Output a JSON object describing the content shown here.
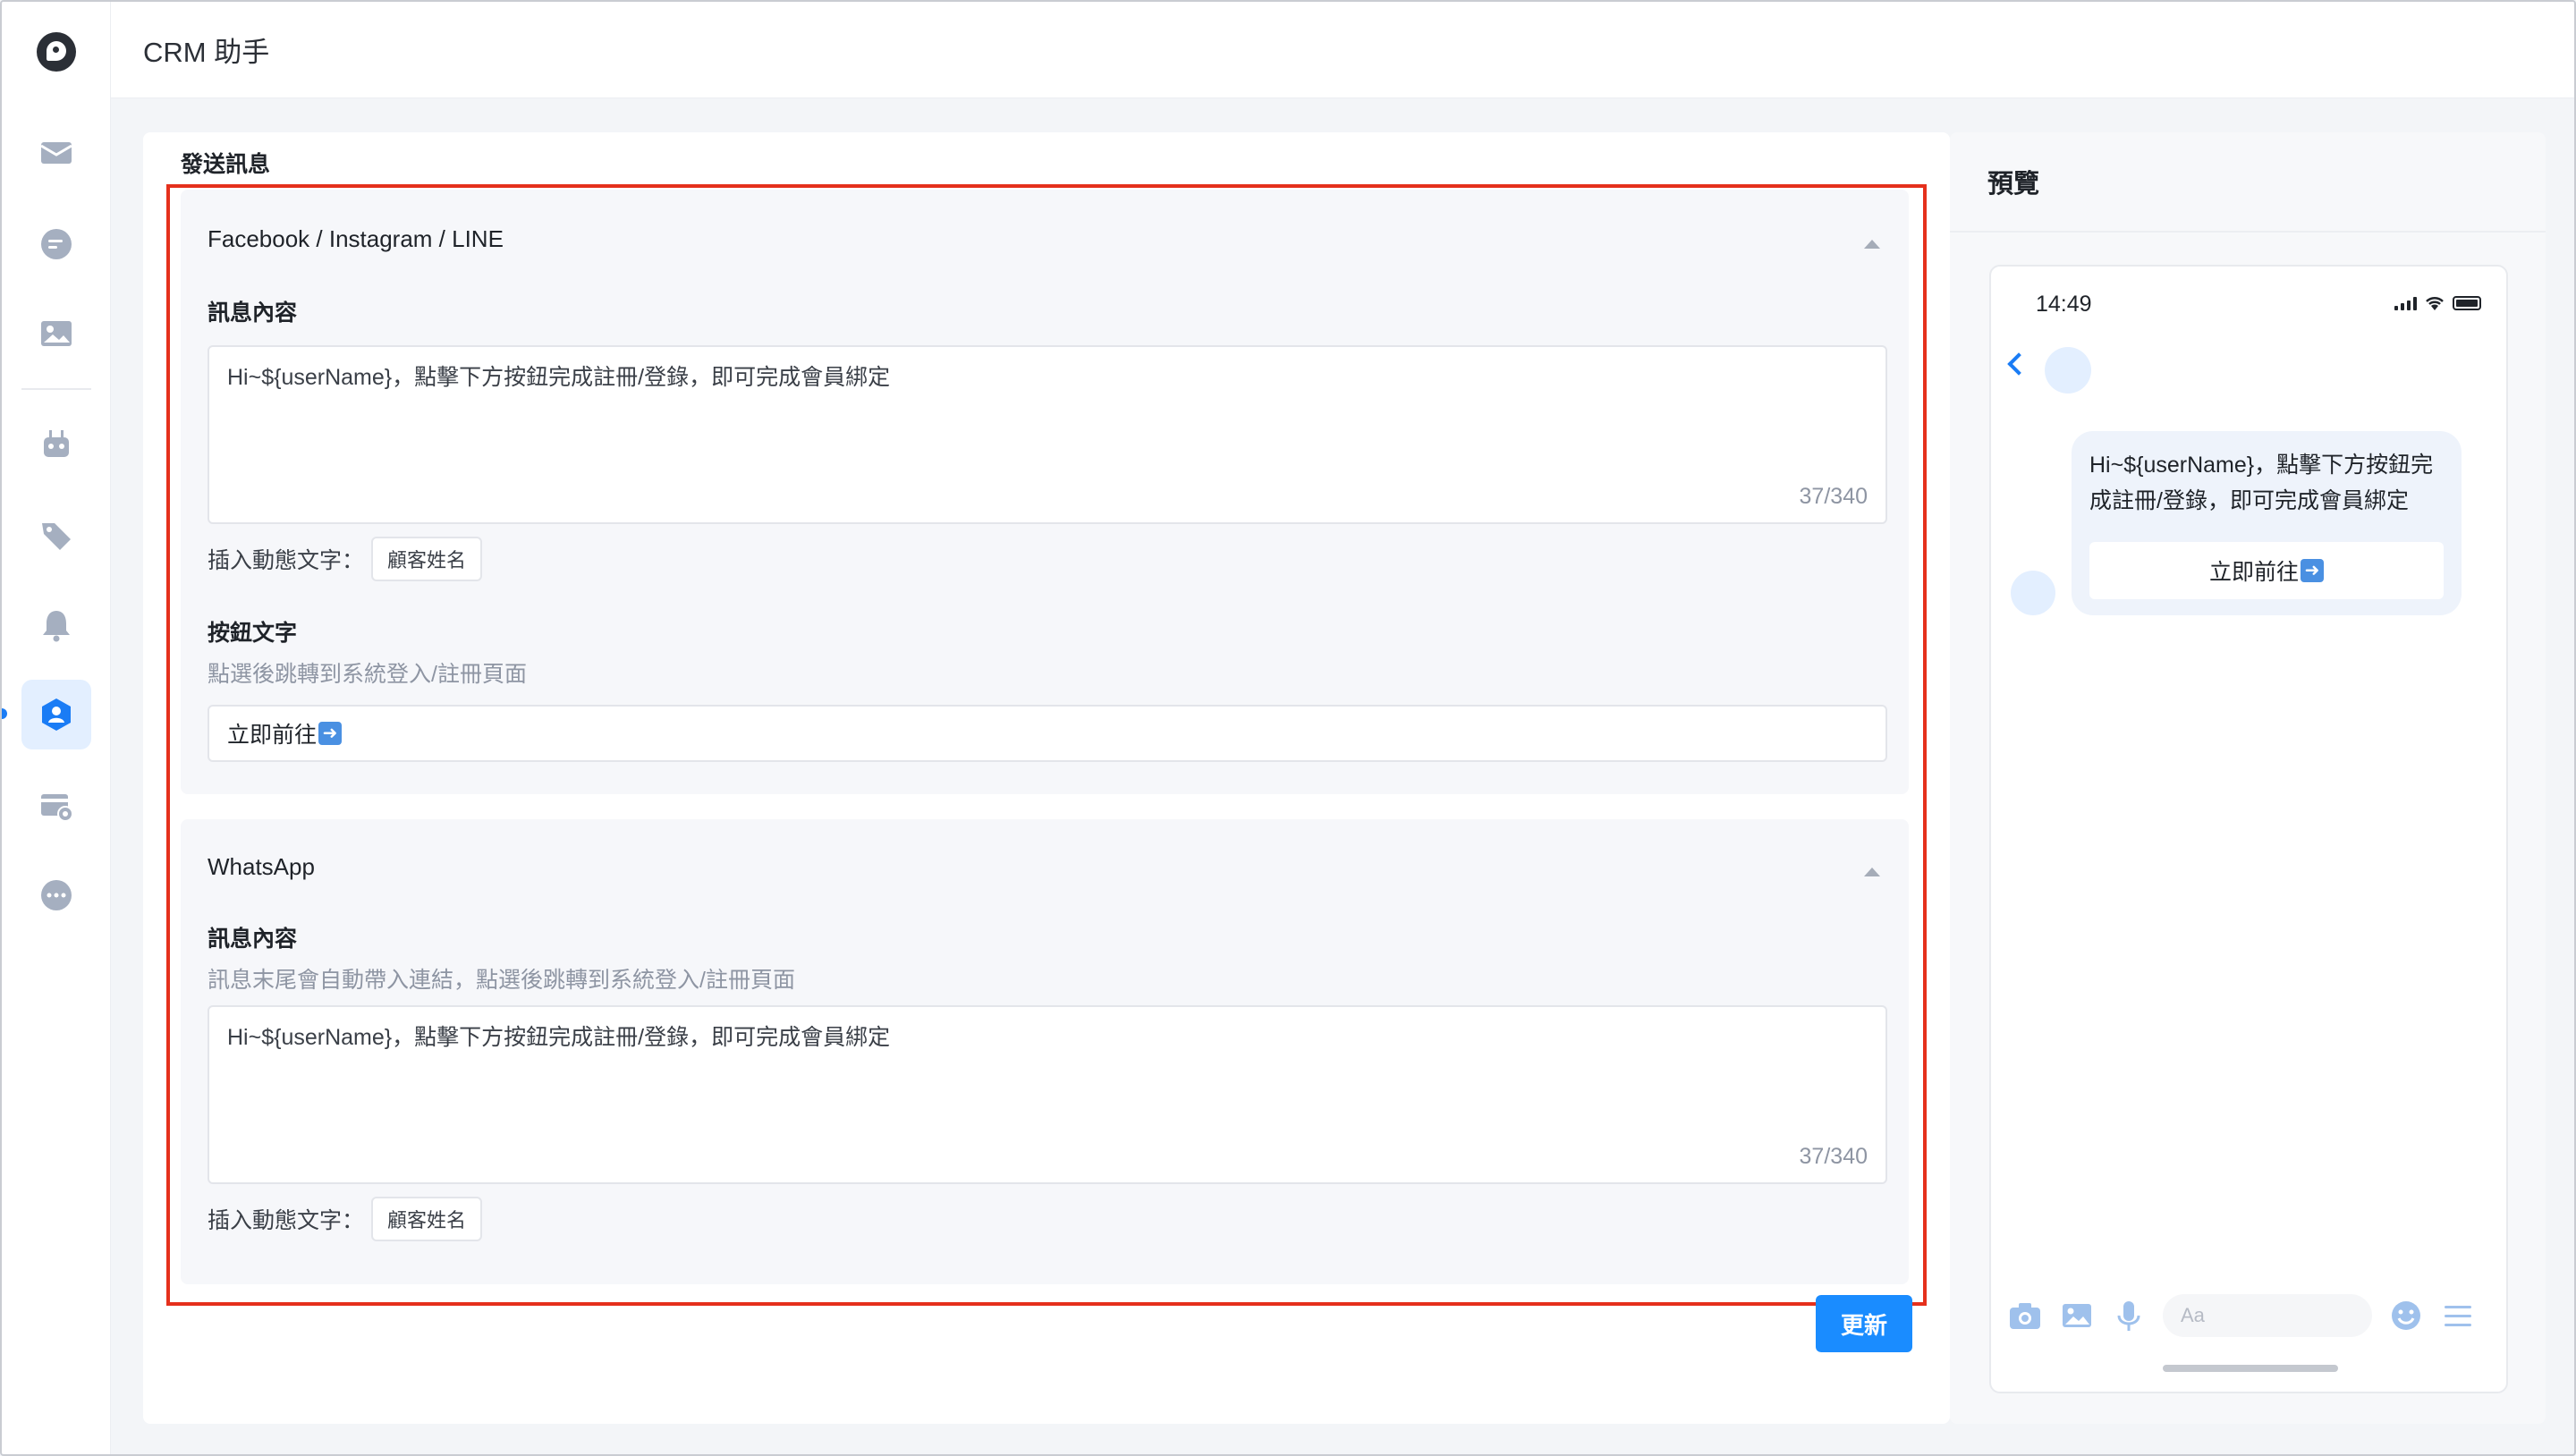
{
  "app": {
    "title": "CRM 助手"
  },
  "sidebar": {
    "items": [
      {
        "icon": "mail-icon"
      },
      {
        "icon": "chat-icon"
      },
      {
        "icon": "image-icon"
      },
      {
        "icon": "robot-icon"
      },
      {
        "icon": "tag-icon"
      },
      {
        "icon": "bell-icon"
      },
      {
        "icon": "member-icon",
        "active": true
      },
      {
        "icon": "card-settings-icon"
      },
      {
        "icon": "more-icon"
      }
    ]
  },
  "main": {
    "section_label": "發送訊息",
    "panels": {
      "social": {
        "title": "Facebook / Instagram / LINE",
        "message_label": "訊息內容",
        "message_text": "Hi~${userName}，點擊下方按鈕完成註冊/登錄，即可完成會員綁定",
        "counter": "37/340",
        "insert_label": "插入動態文字：",
        "insert_chip": "顧客姓名",
        "button_label": "按鈕文字",
        "button_hint": "點選後跳轉到系統登入/註冊頁面",
        "button_text": "立即前往"
      },
      "whatsapp": {
        "title": "WhatsApp",
        "message_label": "訊息內容",
        "message_hint": "訊息末尾會自動帶入連結，點選後跳轉到系統登入/註冊頁面",
        "message_text": "Hi~${userName}，點擊下方按鈕完成註冊/登錄，即可完成會員綁定",
        "counter": "37/340",
        "insert_label": "插入動態文字：",
        "insert_chip": "顧客姓名"
      }
    },
    "update_button": "更新"
  },
  "preview": {
    "title": "預覽",
    "phone": {
      "time": "14:49",
      "bubble_text": "Hi~${userName}，點擊下方按鈕完成註冊/登錄，即可完成會員綁定",
      "bubble_button": "立即前往",
      "input_placeholder": "Aa"
    }
  },
  "colors": {
    "accent": "#1a8cff",
    "highlight_border": "#e5301c",
    "active_bg": "#e3efff"
  }
}
